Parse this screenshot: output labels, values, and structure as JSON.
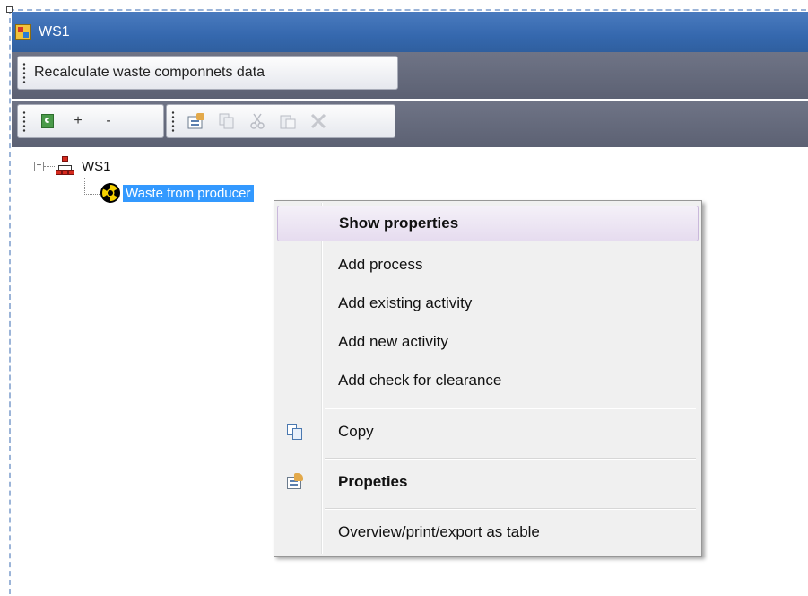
{
  "window": {
    "title": "WS1"
  },
  "toolbar": {
    "recalc_label": "Recalculate waste componnets data",
    "add_symbol": "+",
    "remove_symbol": "-"
  },
  "tree": {
    "root": {
      "label": "WS1",
      "expander": "−"
    },
    "child": {
      "label": "Waste from producer"
    }
  },
  "context_menu": {
    "items": [
      {
        "label": "Show properties"
      },
      {
        "label": "Add process"
      },
      {
        "label": "Add existing activity"
      },
      {
        "label": "Add new activity"
      },
      {
        "label": "Add check for clearance"
      },
      {
        "label": "Copy"
      },
      {
        "label": "Propeties"
      },
      {
        "label": "Overview/print/export as table"
      }
    ]
  },
  "colors": {
    "titlebar": "#3568ae",
    "toolstrip": "#5c6173",
    "selection": "#3399ff",
    "menu_highlight": "#e6dcef"
  },
  "icons": {
    "app": "app-window-icon",
    "refresh": "refresh-icon",
    "properties": "properties-icon",
    "copy": "copy-icon",
    "cut": "cut-icon",
    "paste": "paste-icon",
    "delete": "delete-icon",
    "network": "network-tree-icon",
    "radiation": "radiation-icon"
  }
}
